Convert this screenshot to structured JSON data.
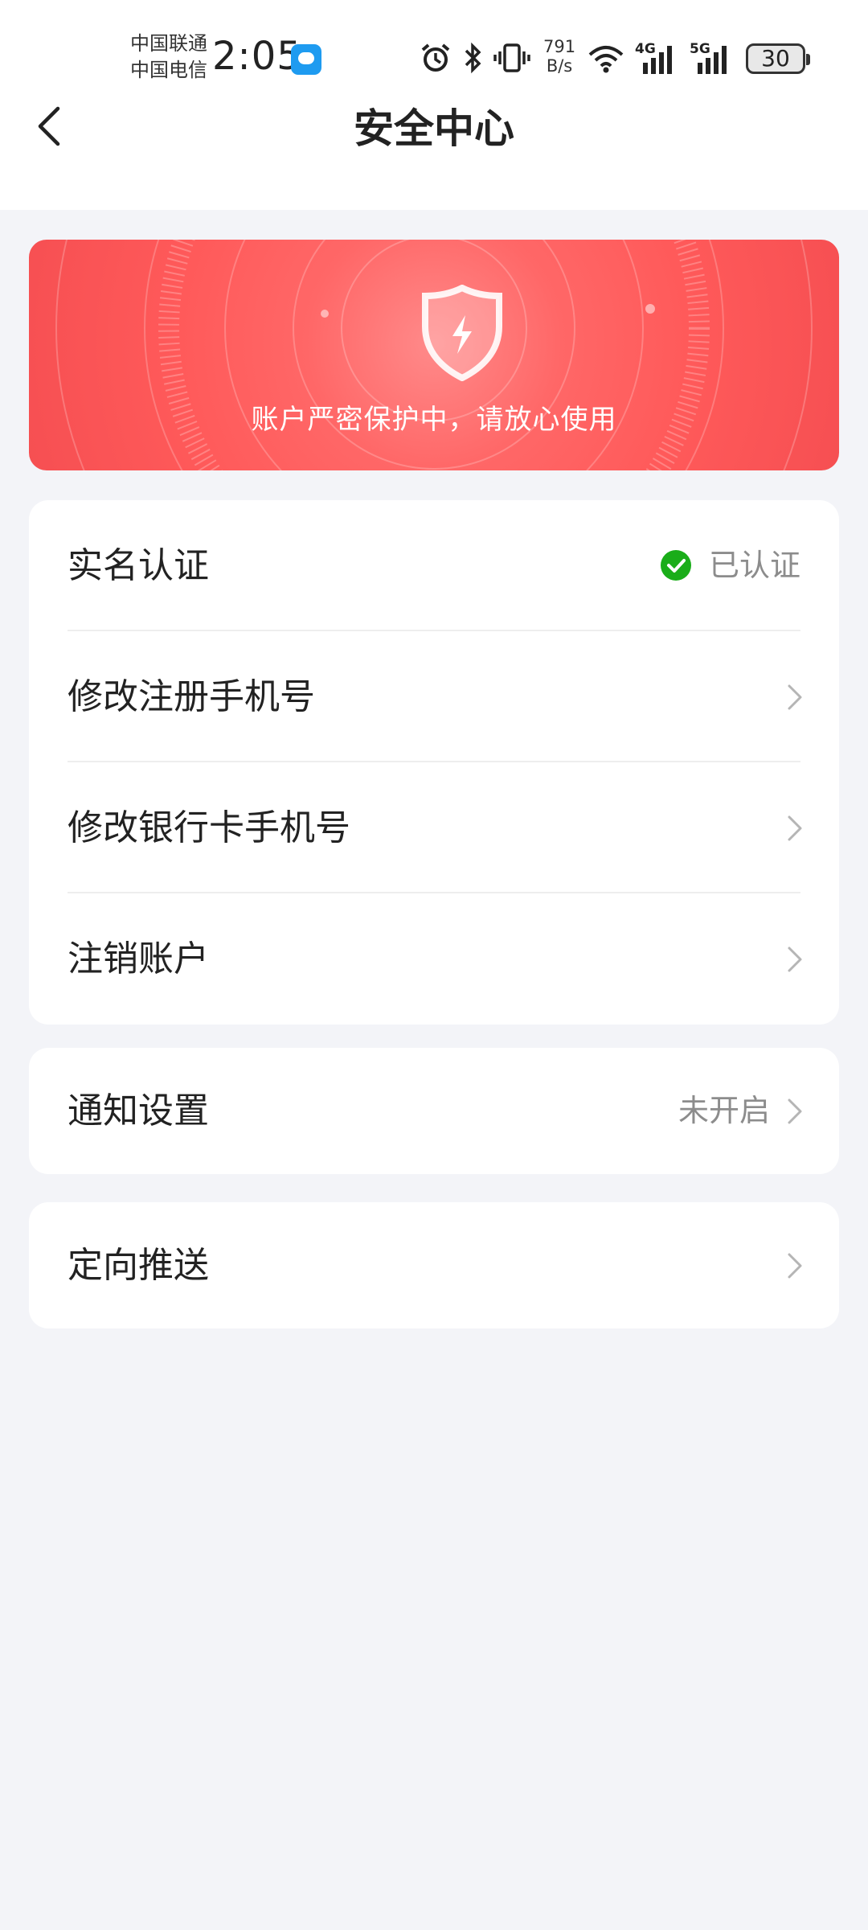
{
  "status_bar": {
    "carrier_1": "中国联通",
    "carrier_2": "中国电信",
    "time": "2:05",
    "net_speed_value": "791",
    "net_speed_unit": "B/s",
    "signal_1": "4G",
    "signal_2": "5G",
    "battery": "30"
  },
  "header": {
    "title": "安全中心"
  },
  "banner": {
    "text": "账户严密保护中，请放心使用"
  },
  "account_section": {
    "items": [
      {
        "label": "实名认证",
        "value": "已认证"
      },
      {
        "label": "修改注册手机号"
      },
      {
        "label": "修改银行卡手机号"
      },
      {
        "label": "注销账户"
      }
    ]
  },
  "notification_section": {
    "label": "通知设置",
    "value": "未开启"
  },
  "push_section": {
    "label": "定向推送"
  },
  "colors": {
    "banner_red": "#FF5A5A",
    "verified_green": "#1AAD19",
    "page_bg": "#F3F4F8"
  }
}
